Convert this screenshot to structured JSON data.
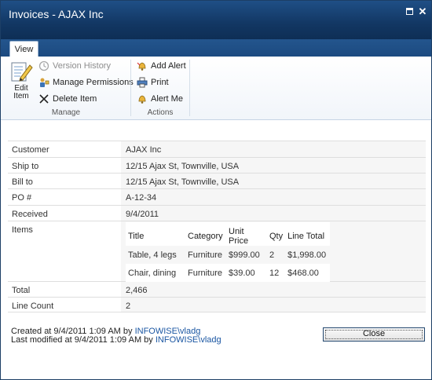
{
  "window": {
    "title": "Invoices - AJAX Inc"
  },
  "tabs": [
    {
      "label": "View"
    }
  ],
  "ribbon": {
    "edit_label_1": "Edit",
    "edit_label_2": "Item",
    "manage": {
      "label": "Manage",
      "items": [
        {
          "label": "Version History",
          "icon": "version-history-icon",
          "enabled": false
        },
        {
          "label": "Manage Permissions",
          "icon": "permissions-icon",
          "enabled": true
        },
        {
          "label": "Delete Item",
          "icon": "delete-icon",
          "enabled": true
        }
      ]
    },
    "actions": {
      "label": "Actions",
      "items": [
        {
          "label": "Add Alert",
          "icon": "alert-icon"
        },
        {
          "label": "Print",
          "icon": "print-icon"
        },
        {
          "label": "Alert Me",
          "icon": "alert-me-icon"
        }
      ]
    }
  },
  "fields": {
    "customer": {
      "label": "Customer",
      "value": "AJAX Inc"
    },
    "ship_to": {
      "label": "Ship to",
      "value": "12/15 Ajax St, Townville, USA"
    },
    "bill_to": {
      "label": "Bill to",
      "value": "12/15 Ajax St, Townville, USA"
    },
    "po": {
      "label": "PO #",
      "value": "A-12-34"
    },
    "received": {
      "label": "Received",
      "value": "9/4/2011"
    },
    "items": {
      "label": "Items"
    },
    "total": {
      "label": "Total",
      "value": "2,466"
    },
    "line_count": {
      "label": "Line Count",
      "value": "2"
    }
  },
  "items_table": {
    "headers": [
      "Title",
      "Category",
      "Unit Price",
      "Qty",
      "Line Total"
    ],
    "rows": [
      [
        "Table, 4 legs",
        "Furniture",
        "$999.00",
        "2",
        "$1,998.00"
      ],
      [
        "Chair, dining",
        "Furniture",
        "$39.00",
        "12",
        "$468.00"
      ]
    ]
  },
  "footer": {
    "created_prefix": "Created at 9/4/2011 1:09 AM by",
    "created_user": "INFOWISE\\vladg",
    "modified_prefix": "Last modified at 9/4/2011 1:09 AM by",
    "modified_user": "INFOWISE\\vladg"
  },
  "buttons": {
    "close": "Close"
  },
  "colors": {
    "title_bar": "#123763",
    "link": "#1a56a2",
    "accent_border": "#24486f"
  }
}
